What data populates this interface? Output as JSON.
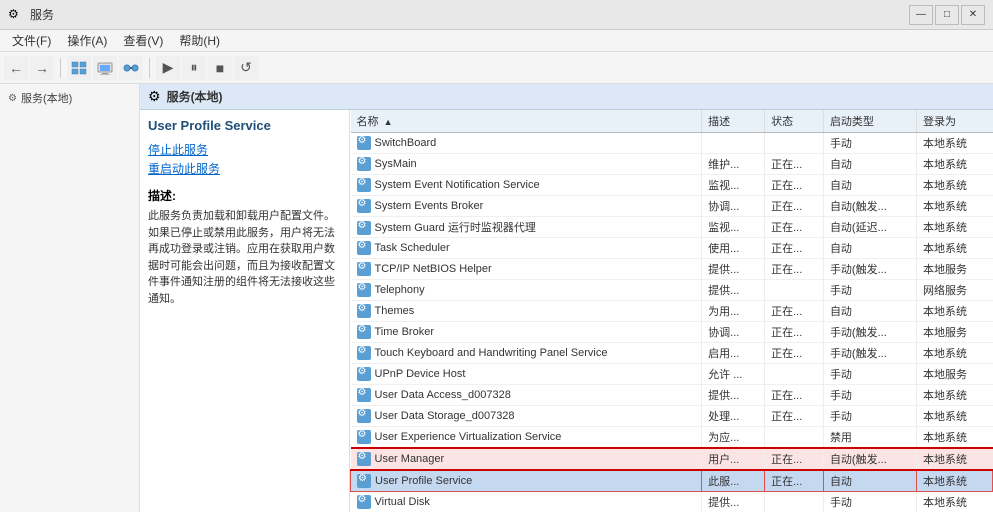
{
  "titleBar": {
    "title": "服务",
    "minimizeLabel": "—",
    "maximizeLabel": "□",
    "closeLabel": "✕"
  },
  "menuBar": {
    "items": [
      "文件(F)",
      "操作(A)",
      "查看(V)",
      "帮助(H)"
    ]
  },
  "toolbar": {
    "buttons": [
      "←",
      "→",
      "⊞",
      "⊡",
      "⊟",
      "⊞",
      "|",
      "▶",
      "⏸",
      "⏹",
      "▶▶"
    ]
  },
  "sidebar": {
    "items": [
      {
        "label": "服务(本地)",
        "icon": "🔧"
      }
    ]
  },
  "panelHeader": {
    "title": "服务(本地)"
  },
  "serviceDetail": {
    "name": "User Profile Service",
    "stopLink": "停止此服务",
    "restartLink": "重启动此服务",
    "descLabel": "描述:",
    "description": "此服务负责加载和卸载用户配置文件。如果已停止或禁用此服务，用户将无法再成功登录或注销。应用在获取用户数据时可能会出问题，而且为接收配置文件事件通知注册的组件将无法接收这些通知。"
  },
  "tableHeaders": [
    "名称",
    "描述",
    "状态",
    "启动类型",
    "登录为"
  ],
  "services": [
    {
      "name": "SwitchBoard",
      "desc": "",
      "status": "",
      "startup": "手动",
      "logon": "本地系统"
    },
    {
      "name": "SysMain",
      "desc": "维护...",
      "status": "正在...",
      "startup": "自动",
      "logon": "本地系统"
    },
    {
      "name": "System Event Notification Service",
      "desc": "监视...",
      "status": "正在...",
      "startup": "自动",
      "logon": "本地系统"
    },
    {
      "name": "System Events Broker",
      "desc": "协调...",
      "status": "正在...",
      "startup": "自动(触发...",
      "logon": "本地系统"
    },
    {
      "name": "System Guard 运行时监视器代理",
      "desc": "监视...",
      "status": "正在...",
      "startup": "自动(延迟...",
      "logon": "本地系统"
    },
    {
      "name": "Task Scheduler",
      "desc": "使用...",
      "status": "正在...",
      "startup": "自动",
      "logon": "本地系统"
    },
    {
      "name": "TCP/IP NetBIOS Helper",
      "desc": "提供...",
      "status": "正在...",
      "startup": "手动(触发...",
      "logon": "本地服务"
    },
    {
      "name": "Telephony",
      "desc": "提供...",
      "status": "",
      "startup": "手动",
      "logon": "网络服务"
    },
    {
      "name": "Themes",
      "desc": "为用...",
      "status": "正在...",
      "startup": "自动",
      "logon": "本地系统"
    },
    {
      "name": "Time Broker",
      "desc": "协调...",
      "status": "正在...",
      "startup": "手动(触发...",
      "logon": "本地服务"
    },
    {
      "name": "Touch Keyboard and Handwriting Panel Service",
      "desc": "启用...",
      "status": "正在...",
      "startup": "手动(触发...",
      "logon": "本地系统"
    },
    {
      "name": "UPnP Device Host",
      "desc": "允许 ...",
      "status": "",
      "startup": "手动",
      "logon": "本地服务"
    },
    {
      "name": "User Data Access_d007328",
      "desc": "提供...",
      "status": "正在...",
      "startup": "手动",
      "logon": "本地系统"
    },
    {
      "name": "User Data Storage_d007328",
      "desc": "处理...",
      "status": "正在...",
      "startup": "手动",
      "logon": "本地系统"
    },
    {
      "name": "User Experience Virtualization Service",
      "desc": "为应...",
      "status": "",
      "startup": "禁用",
      "logon": "本地系统"
    },
    {
      "name": "User Manager",
      "desc": "用户...",
      "status": "正在...",
      "startup": "自动(触发...",
      "logon": "本地系统",
      "highlighted": true
    },
    {
      "name": "User Profile Service",
      "desc": "此服...",
      "status": "正在...",
      "startup": "自动",
      "logon": "本地系统",
      "selected": true
    },
    {
      "name": "Virtual Disk",
      "desc": "提供...",
      "status": "",
      "startup": "手动",
      "logon": "本地系统"
    }
  ]
}
